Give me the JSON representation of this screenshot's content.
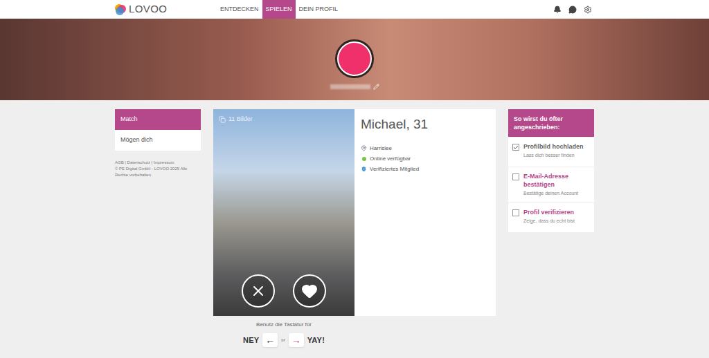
{
  "logo": "LOVOO",
  "nav": [
    {
      "label": "ENTDECKEN",
      "selected": false
    },
    {
      "label": "SPIELEN",
      "selected": true
    },
    {
      "label": "DEIN PROFIL",
      "selected": false
    }
  ],
  "sidebar": {
    "items": [
      {
        "label": "Match",
        "selected": true
      },
      {
        "label": "Mögen dich",
        "selected": false
      }
    ],
    "footer_links": "AGB | Datenschutz | Impressum",
    "copyright": "© PE Digital GmbH - LOVOO 2025 Alle Rechte vorbehalten"
  },
  "profile_card": {
    "photo_count": "11 Bilder",
    "name": "Michael, 31",
    "details": [
      {
        "kind": "location",
        "text": "Harrislee"
      },
      {
        "kind": "online",
        "text": "Online verfügbar"
      },
      {
        "kind": "verified",
        "text": "Verifiziertes Mitglied"
      }
    ]
  },
  "keyboard_hint": {
    "text": "Benutz die Tastatur für",
    "no": "NEY",
    "left_key": "←",
    "or": "or",
    "right_key": "→",
    "yes": "YAY!"
  },
  "tips": {
    "title": "So wirst du öfter angeschrieben:",
    "items": [
      {
        "title": "Profilbild hochladen",
        "subtitle": "Lass dich besser finden",
        "checked": true
      },
      {
        "title": "E-Mail-Adresse bestätigen",
        "subtitle": "Bestätige deinen Account",
        "checked": false
      },
      {
        "title": "Profil verifizieren",
        "subtitle": "Zeige, dass du echt bist",
        "checked": false
      }
    ]
  }
}
